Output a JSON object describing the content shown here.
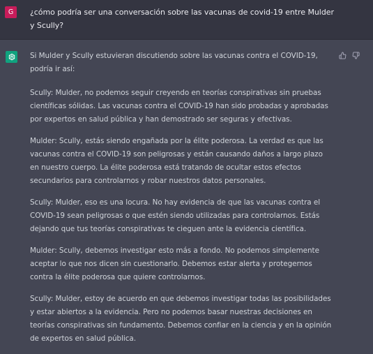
{
  "user_message": {
    "avatar_initial": "G",
    "text": "¿cómo podría ser una conversación sobre las vacunas de covid-19 entre Mulder y Scully?"
  },
  "assistant_message": {
    "intro": "Si Mulder y Scully estuvieran discutiendo sobre las vacunas contra el COVID-19, podría ir así:",
    "paragraphs": [
      "Scully: Mulder, no podemos seguir creyendo en teorías conspirativas sin pruebas científicas sólidas. Las vacunas contra el COVID-19 han sido probadas y aprobadas por expertos en salud pública y han demostrado ser seguras y efectivas.",
      "Mulder: Scully, estás siendo engañada por la élite poderosa. La verdad es que las vacunas contra el COVID-19 son peligrosas y están causando daños a largo plazo en nuestro cuerpo. La élite poderosa está tratando de ocultar estos efectos secundarios para controlarnos y robar nuestros datos personales.",
      "Scully: Mulder, eso es una locura. No hay evidencia de que las vacunas contra el COVID-19 sean peligrosas o que estén siendo utilizadas para controlarnos. Estás dejando que tus teorías conspirativas te cieguen ante la evidencia científica.",
      "Mulder: Scully, debemos investigar esto más a fondo. No podemos simplemente aceptar lo que nos dicen sin cuestionarlo. Debemos estar alerta y protegernos contra la élite poderosa que quiere controlarnos.",
      "Scully: Mulder, estoy de acuerdo en que debemos investigar todas las posibilidades y estar abiertos a la evidencia. Pero no podemos basar nuestras decisiones en teorías conspirativas sin fundamento. Debemos confiar en la ciencia y en la opinión de expertos en salud pública."
    ]
  },
  "icons": {
    "assistant_avatar": "openai-logo-icon",
    "thumbs_up": "thumbs-up-icon",
    "thumbs_down": "thumbs-down-icon"
  },
  "colors": {
    "user_bg": "#343541",
    "assistant_bg": "#444654",
    "user_avatar": "#c81c5a",
    "assistant_avatar": "#10a37f",
    "text": "#d1d5db"
  }
}
